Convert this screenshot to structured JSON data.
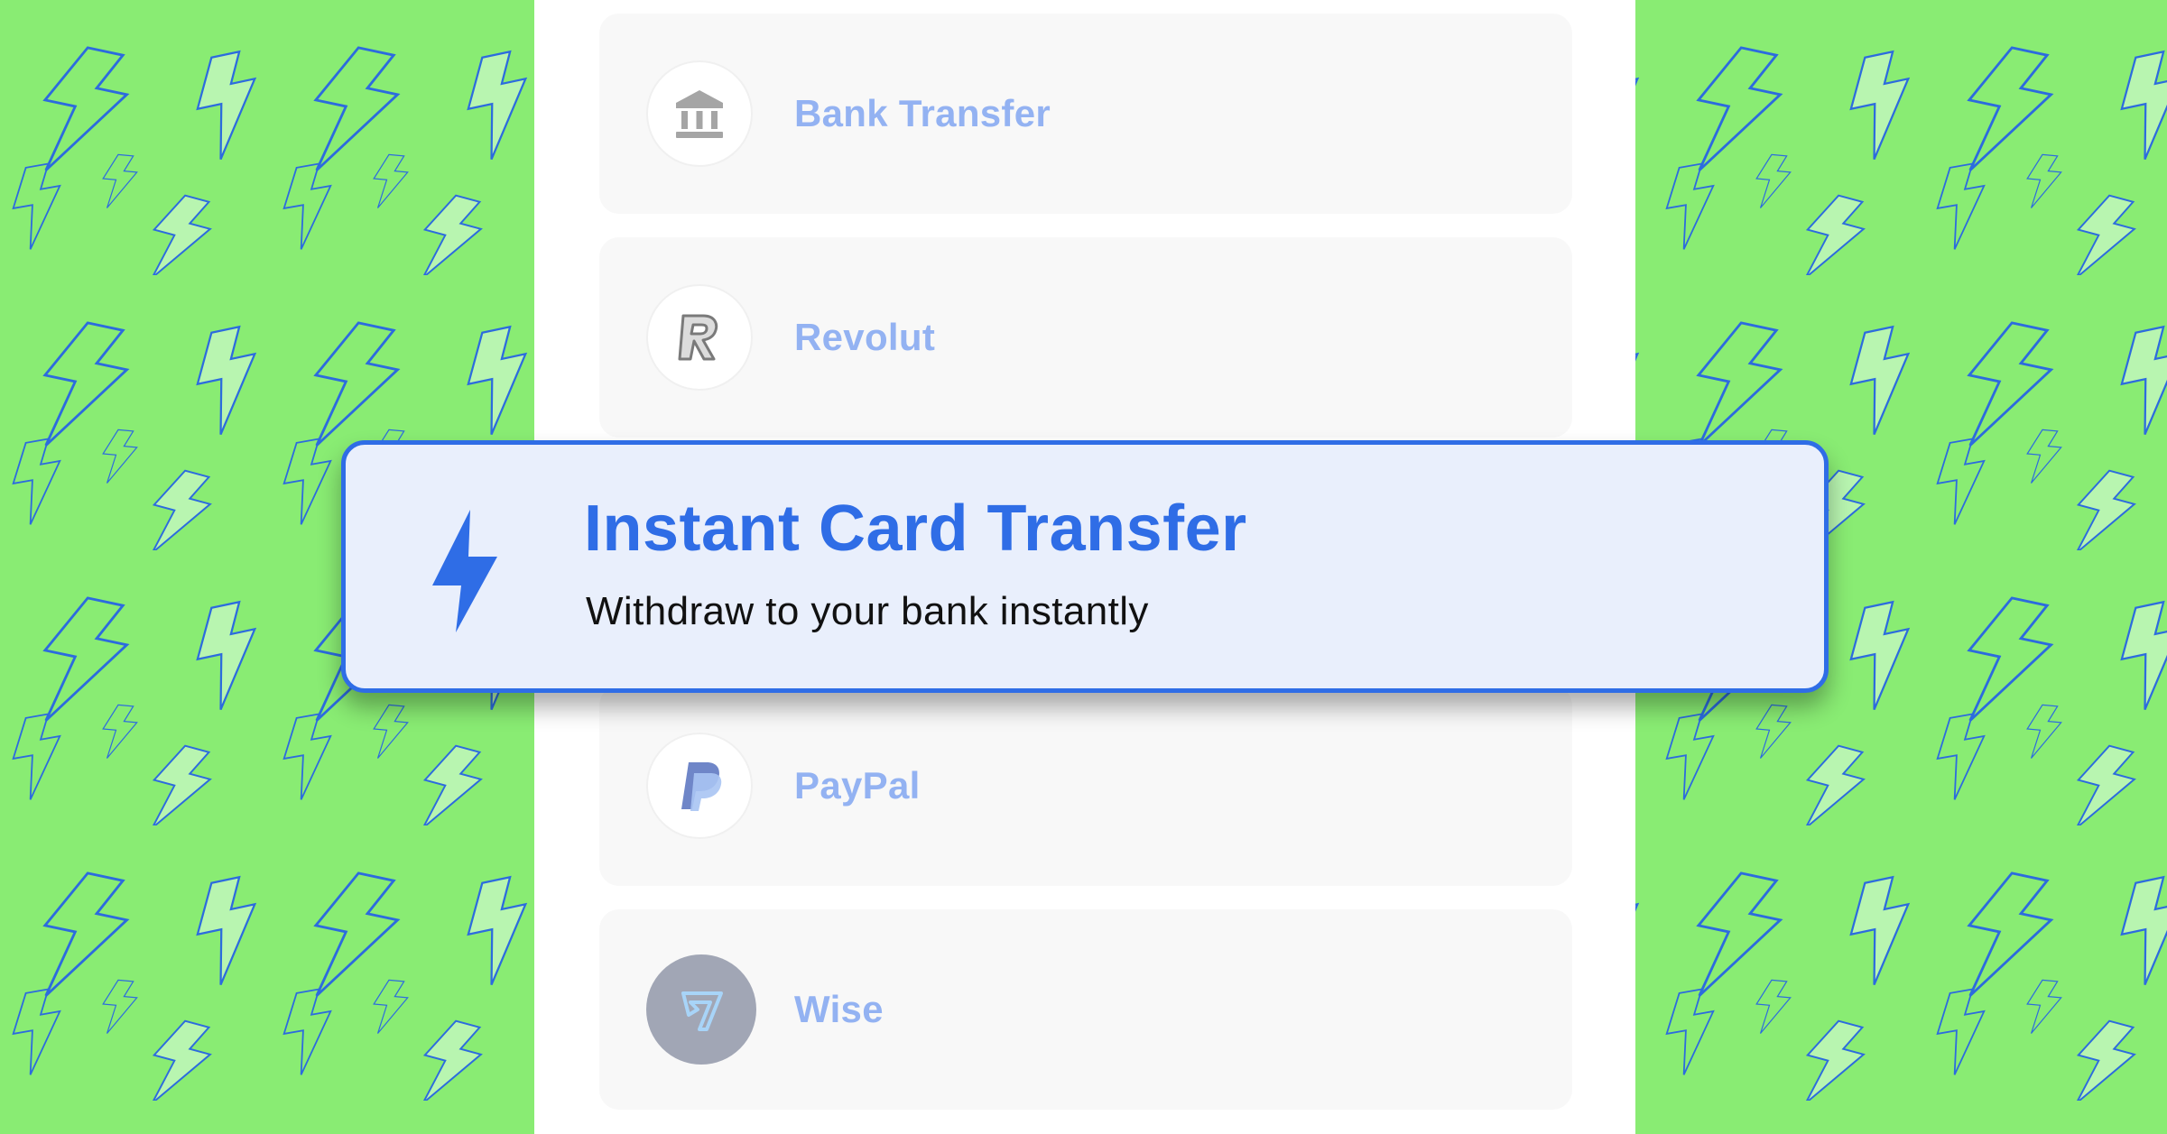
{
  "colors": {
    "background_green": "#89ec73",
    "bolt_stroke": "#2c6bde",
    "bolt_fill_light": "#b8f5b0",
    "accent_blue": "#2f6de6",
    "highlight_bg": "#e9effc",
    "method_label": "#93b2f2",
    "card_bg": "#f8f8f8"
  },
  "background": {
    "pattern_icon": "lightning-bolt-icon"
  },
  "payment_methods": [
    {
      "label": "Bank Transfer",
      "icon": "bank-icon"
    },
    {
      "label": "Revolut",
      "icon": "revolut-logo-icon"
    },
    {
      "label": "PayPal",
      "icon": "paypal-logo-icon"
    },
    {
      "label": "Wise",
      "icon": "wise-logo-icon"
    }
  ],
  "highlight": {
    "title": "Instant Card Transfer",
    "subtitle": "Withdraw to your bank instantly",
    "icon": "lightning-bolt-icon"
  }
}
